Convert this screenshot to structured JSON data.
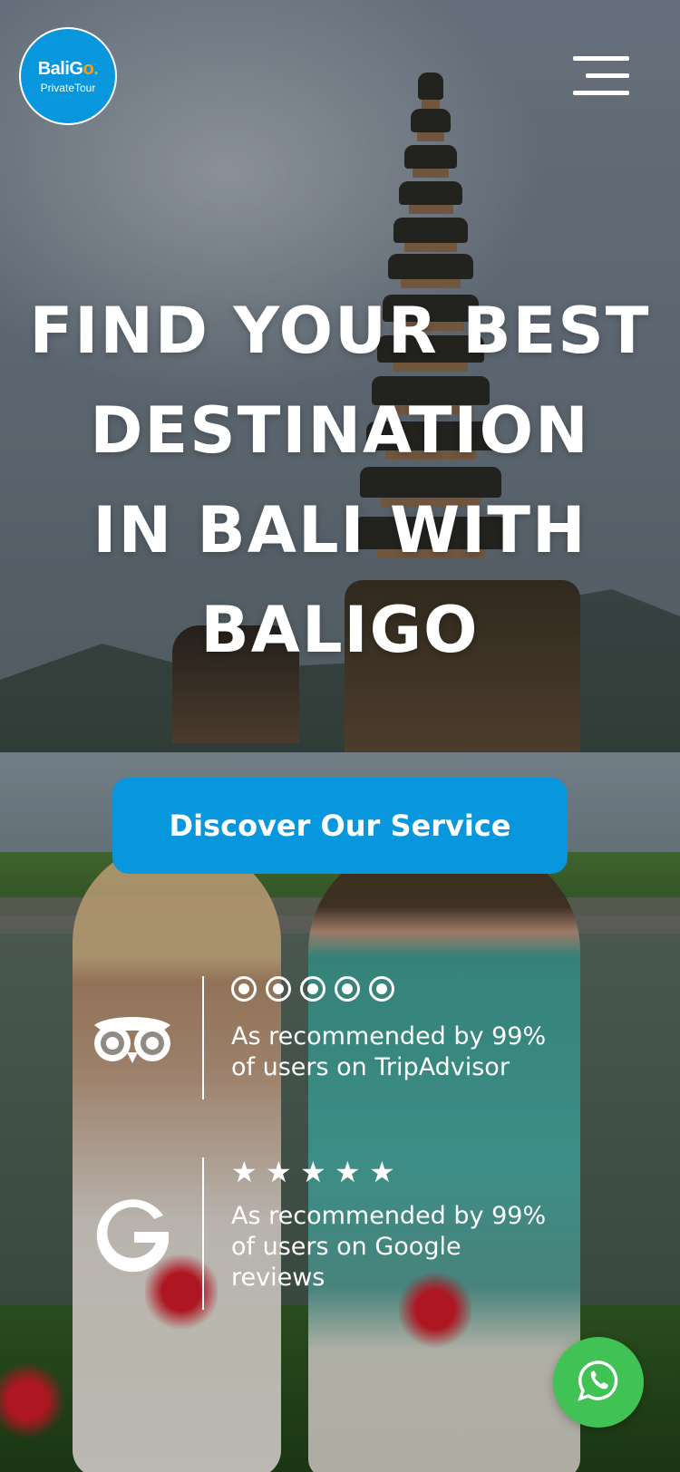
{
  "brand": {
    "logo_main": "BaliG",
    "logo_main_accent": "o.",
    "logo_sub": "PrivateTour",
    "accent_color": "#0896dc",
    "logo_accent_color": "#f3a21b"
  },
  "header": {
    "menu_icon": "hamburger-menu-icon"
  },
  "hero": {
    "title_lines": [
      "FIND YOUR BEST",
      "DESTINATION",
      "IN BALI WITH",
      "BALIGO"
    ],
    "cta_label": "Discover Our Service"
  },
  "reviews": [
    {
      "icon": "tripadvisor-owl-icon",
      "rating_icon": "tripadvisor-bubble",
      "rating": 5,
      "text": "As recommended by 99% of users on TripAdvisor"
    },
    {
      "icon": "google-g-icon",
      "rating_icon": "star",
      "rating": 5,
      "text": "As recommended by 99% of users on Google reviews"
    }
  ],
  "whatsapp": {
    "icon": "whatsapp-icon",
    "color": "#41c255"
  }
}
